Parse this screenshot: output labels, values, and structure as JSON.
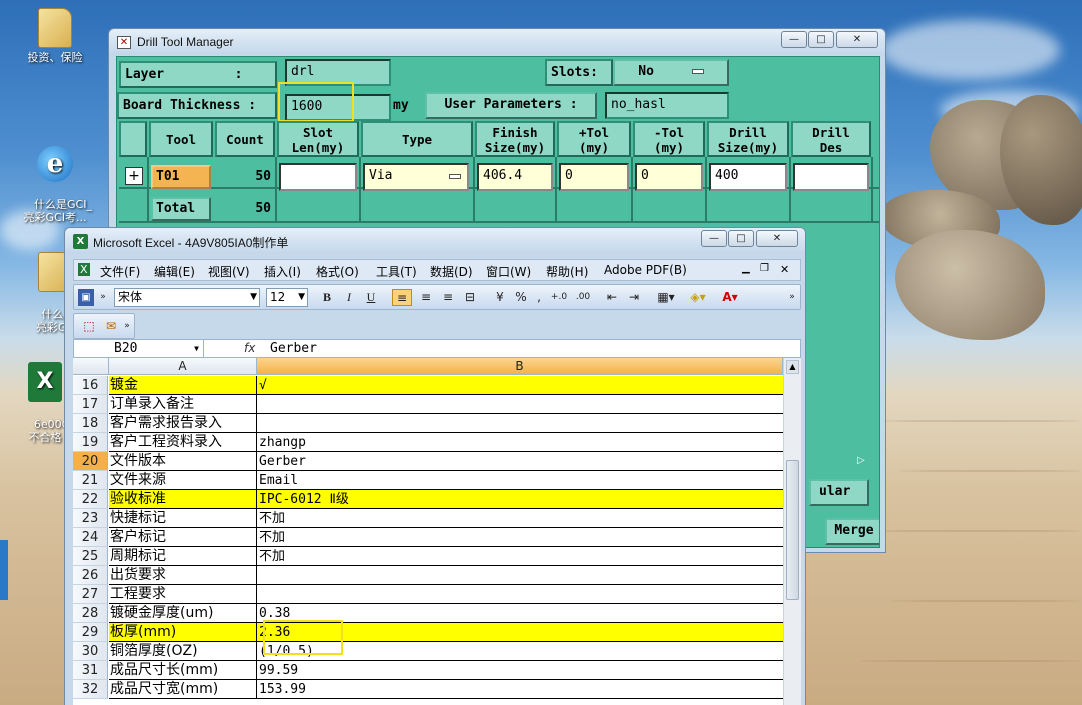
{
  "desktop": {
    "icons": [
      {
        "label": "投资、保险",
        "kind": "folder"
      },
      {
        "label": "什么是GCI_\n亮彩GCI考...",
        "kind": "ie"
      },
      {
        "label": "什么是G\n亮彩GC",
        "kind": "folder"
      },
      {
        "label": "6e00G\n不合格",
        "kind": "excel"
      }
    ]
  },
  "drill": {
    "title": "Drill Tool Manager",
    "minimize": "—",
    "maximize": "□",
    "close": "✕",
    "layer_label": "Layer         :",
    "layer_value": "drl",
    "slots_label": "Slots:",
    "slots_value": "No",
    "thickness_label": "Board Thickness :",
    "thickness_value": "1600",
    "thickness_unit": "my",
    "user_params_label": "User Parameters :",
    "user_params_value": "no_hasl",
    "columns": {
      "tool": "Tool",
      "count": "Count",
      "slot": "Slot\nLen(my)",
      "type": "Type",
      "finish": "Finish\nSize(my)",
      "ptol": "+Tol\n(my)",
      "ntol": "-Tol\n(my)",
      "drill_size": "Drill\nSize(my)",
      "drill_des": "Drill\nDes"
    },
    "row": {
      "tool": "T01",
      "count": "50",
      "slot": "",
      "type": "Via",
      "finish": "406.4",
      "ptol": "0",
      "ntol": "0",
      "drill_size": "400",
      "drill_des": ""
    },
    "total": {
      "label": "Total",
      "count": "50"
    },
    "partial_dropdown": "ular",
    "merge_label": "Merge"
  },
  "excel": {
    "title": "Microsoft Excel - 4A9V805IA0制作单",
    "menu": [
      "文件(F)",
      "编辑(E)",
      "视图(V)",
      "插入(I)",
      "格式(O)",
      "工具(T)",
      "数据(D)",
      "窗口(W)",
      "帮助(H)",
      "Adobe PDF(B)"
    ],
    "font_name": "宋体",
    "font_size": "12",
    "name_box": "B20",
    "fx": "fx",
    "formula": "Gerber",
    "col_a": "A",
    "col_b": "B",
    "rows": [
      {
        "num": "16",
        "a": "镀金",
        "b": "√",
        "yellow": true
      },
      {
        "num": "17",
        "a": "订单录入备注",
        "b": ""
      },
      {
        "num": "18",
        "a": "客户需求报告录入",
        "b": ""
      },
      {
        "num": "19",
        "a": "客户工程资料录入",
        "b": "zhangp"
      },
      {
        "num": "20",
        "a": "文件版本",
        "b": "Gerber",
        "selected": true
      },
      {
        "num": "21",
        "a": "文件来源",
        "b": "Email"
      },
      {
        "num": "22",
        "a": "验收标准",
        "b": "IPC-6012 Ⅱ级",
        "yellow": true
      },
      {
        "num": "23",
        "a": "快捷标记",
        "b": "不加"
      },
      {
        "num": "24",
        "a": "客户标记",
        "b": "不加"
      },
      {
        "num": "25",
        "a": "周期标记",
        "b": "不加"
      },
      {
        "num": "26",
        "a": "出货要求",
        "b": ""
      },
      {
        "num": "27",
        "a": "工程要求",
        "b": ""
      },
      {
        "num": "28",
        "a": "镀硬金厚度(um)",
        "b": "0.38"
      },
      {
        "num": "29",
        "a": "板厚(mm)",
        "b": "2.36",
        "yellow": true
      },
      {
        "num": "30",
        "a": "铜箔厚度(OZ)",
        "b": "(1/0.5)"
      },
      {
        "num": "31",
        "a": "成品尺寸长(mm)",
        "b": "99.59"
      },
      {
        "num": "32",
        "a": "成品尺寸宽(mm)",
        "b": "153.99"
      }
    ]
  },
  "colors": {
    "teal": "#4dbfa0",
    "teal_light": "#8fd8c6",
    "highlight": "#f0e020",
    "excel_yellow": "#ffff00",
    "selected_header": "#f6b04a"
  }
}
